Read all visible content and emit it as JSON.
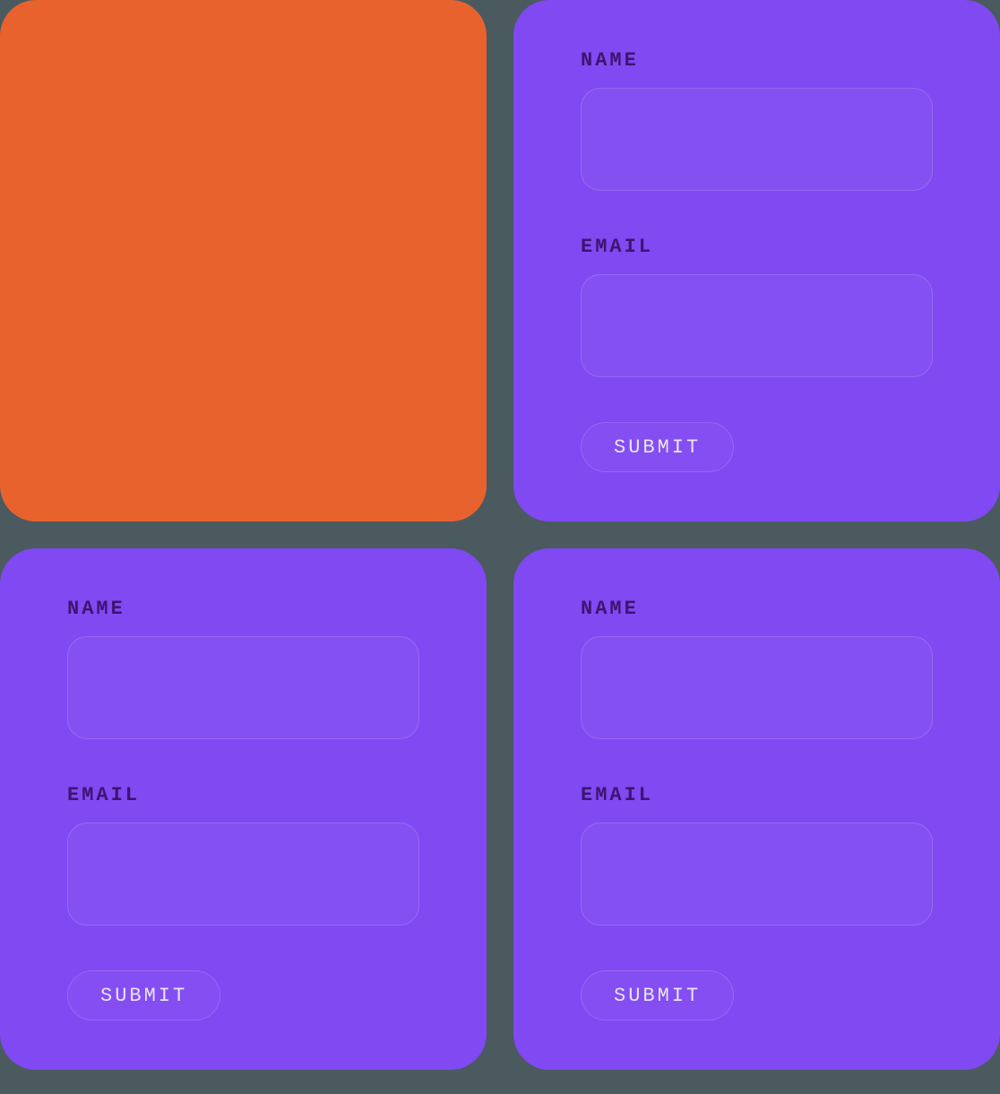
{
  "cards": [
    {
      "type": "orange"
    },
    {
      "type": "purple",
      "form": {
        "name_label": "NAME",
        "email_label": "EMAIL",
        "submit_label": "SUBMIT"
      }
    },
    {
      "type": "purple",
      "form": {
        "name_label": "NAME",
        "email_label": "EMAIL",
        "submit_label": "SUBMIT"
      }
    },
    {
      "type": "purple",
      "form": {
        "name_label": "NAME",
        "email_label": "EMAIL",
        "submit_label": "SUBMIT"
      }
    }
  ]
}
